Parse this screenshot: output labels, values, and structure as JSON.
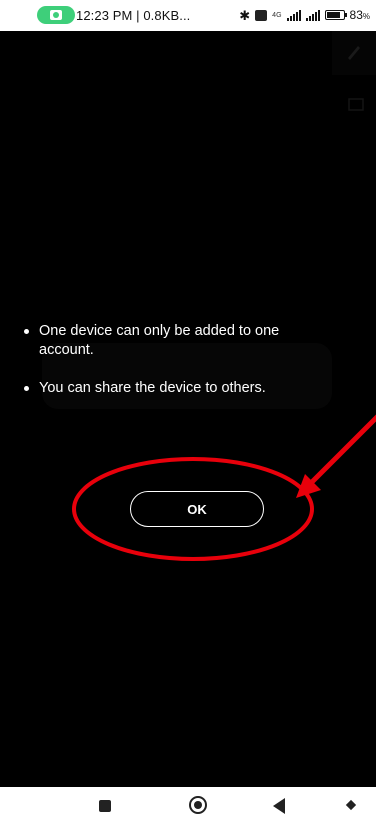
{
  "status_bar": {
    "left_text": "12:23 PM | 0.8KB...",
    "network_label": "4G",
    "battery_level": "83",
    "battery_suffix": "%",
    "icons": [
      "camera-recording-icon",
      "bluetooth-icon",
      "volte-icon",
      "signal-icon",
      "battery-icon"
    ]
  },
  "dialog": {
    "bullets": [
      "One device can only be added to one account.",
      "You can share the device to others."
    ],
    "ok_label": "OK"
  },
  "nav_bar": {
    "icons": [
      "recents-icon",
      "home-icon",
      "back-icon",
      "assist-icon"
    ]
  },
  "colors": {
    "screen_background": "#000000",
    "status_bar_background": "#ffffff",
    "recording_pill": "#3ecf7a",
    "annotation_red": "#e8000b",
    "text_on_dark": "#ffffff"
  }
}
